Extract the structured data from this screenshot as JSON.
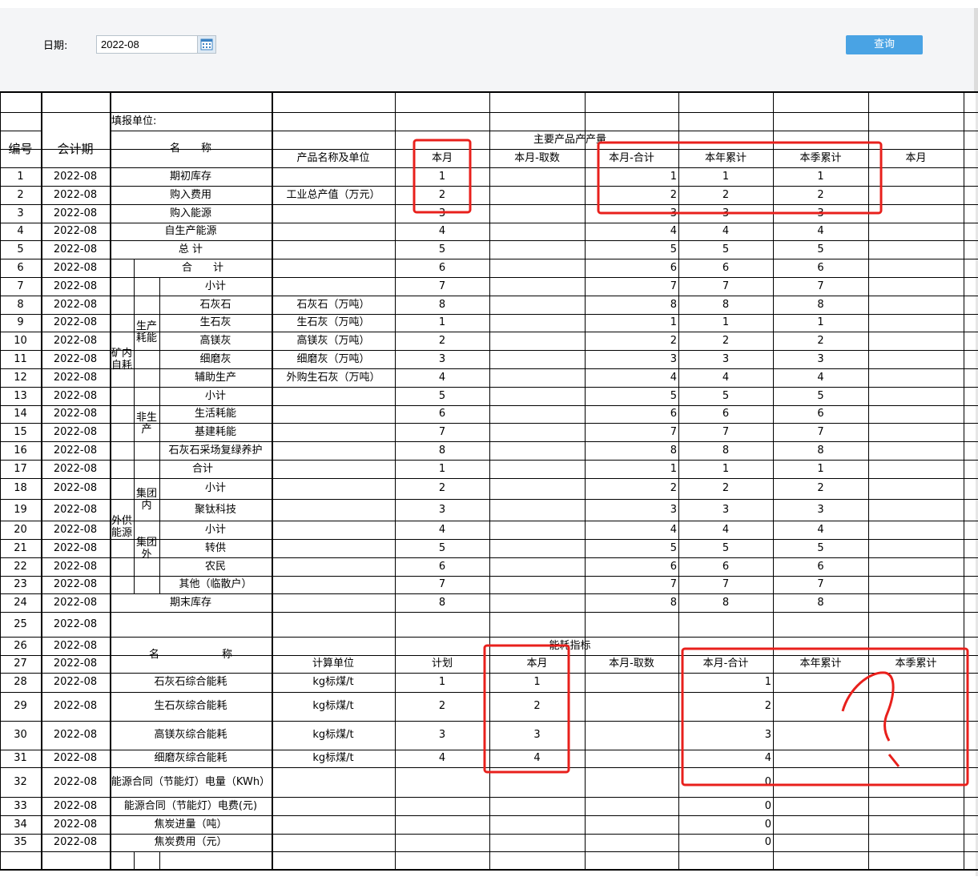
{
  "toolbar": {
    "date_label": "日期:",
    "date_value": "2022-08",
    "query_label": "查询"
  },
  "report": {
    "header": {
      "fill_unit": "填报单位:",
      "col_no": "编号",
      "col_period": "会计期",
      "col_name": "名　　称",
      "group_output": "主要产品产产量",
      "sub_product": "产品名称及单位",
      "sub_month": "本月",
      "sub_month_fetch": "本月-取数",
      "sub_month_total": "本月-合计",
      "sub_year_cum": "本年累计",
      "sub_quarter_cum": "本季累计",
      "sub_month2": "本月"
    },
    "groups": {
      "mine_self": "矿内自耗",
      "production": "生产耗能",
      "non_production": "非生产",
      "external_supply": "外供能源",
      "in_group": "集团内",
      "out_group": "集团外"
    },
    "rows": [
      {
        "no": "1",
        "period": "2022-08",
        "name": "期初库存",
        "product": "",
        "month": "1",
        "total": "1",
        "year": "1",
        "quarter": "1"
      },
      {
        "no": "2",
        "period": "2022-08",
        "name": "购入费用",
        "product": "工业总产值（万元）",
        "month": "2",
        "total": "2",
        "year": "2",
        "quarter": "2"
      },
      {
        "no": "3",
        "period": "2022-08",
        "name": "购入能源",
        "product": "",
        "month": "3",
        "total": "3",
        "year": "3",
        "quarter": "3"
      },
      {
        "no": "4",
        "period": "2022-08",
        "name": "自生产能源",
        "product": "",
        "month": "4",
        "total": "4",
        "year": "4",
        "quarter": "4"
      },
      {
        "no": "5",
        "period": "2022-08",
        "name": "总 计",
        "product": "",
        "month": "5",
        "total": "5",
        "year": "5",
        "quarter": "5"
      },
      {
        "no": "6",
        "period": "2022-08",
        "name": "合　　计",
        "product": "",
        "month": "6",
        "total": "6",
        "year": "6",
        "quarter": "6"
      },
      {
        "no": "7",
        "period": "2022-08",
        "name": "小计",
        "product": "",
        "month": "7",
        "total": "7",
        "year": "7",
        "quarter": "7"
      },
      {
        "no": "8",
        "period": "2022-08",
        "name": "石灰石",
        "product": "石灰石（万吨）",
        "month": "8",
        "total": "8",
        "year": "8",
        "quarter": "8"
      },
      {
        "no": "9",
        "period": "2022-08",
        "name": "生石灰",
        "product": "生石灰（万吨）",
        "month": "1",
        "total": "1",
        "year": "1",
        "quarter": "1"
      },
      {
        "no": "10",
        "period": "2022-08",
        "name": "高镁灰",
        "product": "高镁灰（万吨）",
        "month": "2",
        "total": "2",
        "year": "2",
        "quarter": "2"
      },
      {
        "no": "11",
        "period": "2022-08",
        "name": "细磨灰",
        "product": "细磨灰（万吨）",
        "month": "3",
        "total": "3",
        "year": "3",
        "quarter": "3"
      },
      {
        "no": "12",
        "period": "2022-08",
        "name": "辅助生产",
        "product": "外购生石灰（万吨）",
        "month": "4",
        "total": "4",
        "year": "4",
        "quarter": "4"
      },
      {
        "no": "13",
        "period": "2022-08",
        "name": "小计",
        "product": "",
        "month": "5",
        "total": "5",
        "year": "5",
        "quarter": "5"
      },
      {
        "no": "14",
        "period": "2022-08",
        "name": "生活耗能",
        "product": "",
        "month": "6",
        "total": "6",
        "year": "6",
        "quarter": "6"
      },
      {
        "no": "15",
        "period": "2022-08",
        "name": "基建耗能",
        "product": "",
        "month": "7",
        "total": "7",
        "year": "7",
        "quarter": "7"
      },
      {
        "no": "16",
        "period": "2022-08",
        "name": "石灰石采场复绿养护",
        "product": "",
        "month": "8",
        "total": "8",
        "year": "8",
        "quarter": "8"
      },
      {
        "no": "17",
        "period": "2022-08",
        "name": "合计",
        "product": "",
        "month": "1",
        "total": "1",
        "year": "1",
        "quarter": "1"
      },
      {
        "no": "18",
        "period": "2022-08",
        "name": "小计",
        "product": "",
        "month": "2",
        "total": "2",
        "year": "2",
        "quarter": "2"
      },
      {
        "no": "19",
        "period": "2022-08",
        "name": "聚钛科技",
        "product": "",
        "month": "3",
        "total": "3",
        "year": "3",
        "quarter": "3"
      },
      {
        "no": "20",
        "period": "2022-08",
        "name": "小计",
        "product": "",
        "month": "4",
        "total": "4",
        "year": "4",
        "quarter": "4"
      },
      {
        "no": "21",
        "period": "2022-08",
        "name": "转供",
        "product": "",
        "month": "5",
        "total": "5",
        "year": "5",
        "quarter": "5"
      },
      {
        "no": "22",
        "period": "2022-08",
        "name": "农民",
        "product": "",
        "month": "6",
        "total": "6",
        "year": "6",
        "quarter": "6"
      },
      {
        "no": "23",
        "period": "2022-08",
        "name": "其他（临散户）",
        "product": "",
        "month": "7",
        "total": "7",
        "year": "7",
        "quarter": "7"
      },
      {
        "no": "24",
        "period": "2022-08",
        "name": "期末库存",
        "product": "",
        "month": "8",
        "total": "8",
        "year": "8",
        "quarter": "8"
      },
      {
        "no": "25",
        "period": "2022-08"
      }
    ],
    "energy_header": {
      "group": "能耗指标",
      "name": "名　　　　　　称",
      "unit": "计算单位",
      "plan": "计划",
      "month": "本月",
      "month_fetch": "本月-取数",
      "month_total": "本月-合计",
      "year_cum": "本年累计",
      "quarter_cum": "本季累计"
    },
    "energy_rows": [
      {
        "no": "26",
        "period": "2022-08"
      },
      {
        "no": "27",
        "period": "2022-08"
      },
      {
        "no": "28",
        "period": "2022-08",
        "name": "石灰石综合能耗",
        "unit": "kg标煤/t",
        "plan": "1",
        "month": "1",
        "total": "1"
      },
      {
        "no": "29",
        "period": "2022-08",
        "name": "生石灰综合能耗",
        "unit": "kg标煤/t",
        "plan": "2",
        "month": "2",
        "total": "2"
      },
      {
        "no": "30",
        "period": "2022-08",
        "name": "高镁灰综合能耗",
        "unit": "kg标煤/t",
        "plan": "3",
        "month": "3",
        "total": "3"
      },
      {
        "no": "31",
        "period": "2022-08",
        "name": "细磨灰综合能耗",
        "unit": "kg标煤/t",
        "plan": "4",
        "month": "4",
        "total": "4"
      },
      {
        "no": "32",
        "period": "2022-08",
        "name": "能源合同（节能灯）电量（KWh）",
        "total": "0"
      },
      {
        "no": "33",
        "period": "2022-08",
        "name": "能源合同（节能灯）电费(元)",
        "total": "0"
      },
      {
        "no": "34",
        "period": "2022-08",
        "name": "焦炭进量（吨）",
        "total": "0"
      },
      {
        "no": "35",
        "period": "2022-08",
        "name": "焦炭费用（元）",
        "total": "0"
      }
    ]
  },
  "annotation": {
    "color": "#e8201c",
    "mark": "?"
  },
  "colors": {
    "query_button": "#49a3e4",
    "toolbar_bg": "#f4f5f7"
  }
}
